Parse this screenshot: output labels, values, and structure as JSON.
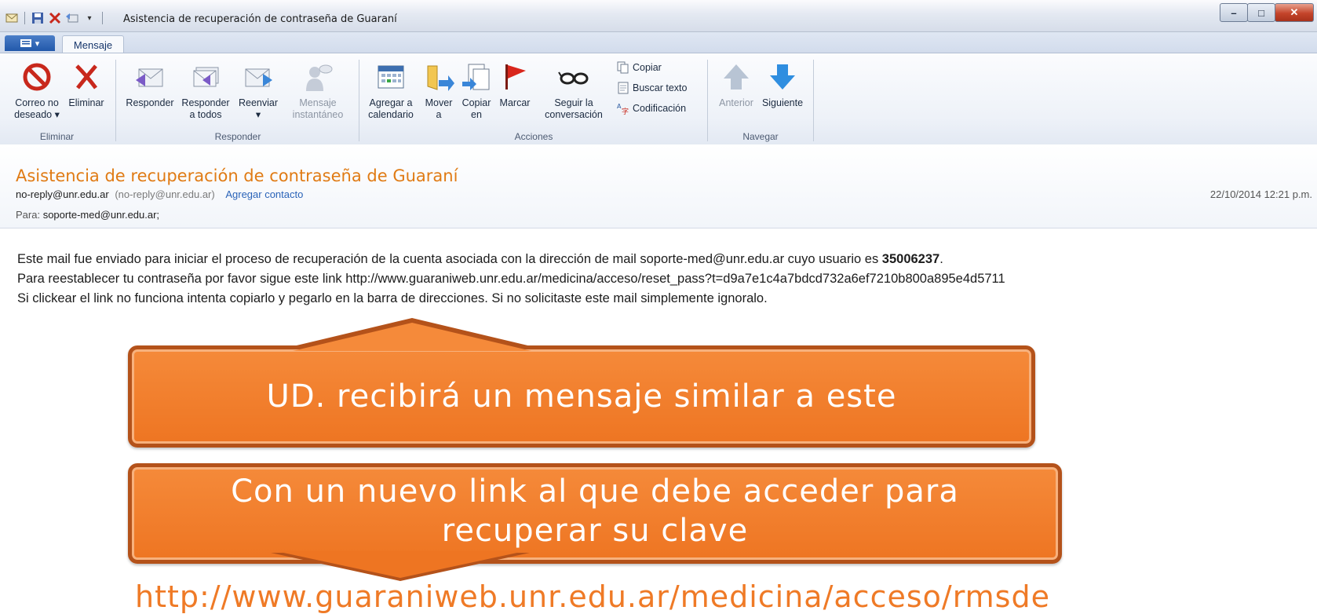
{
  "window": {
    "title": "Asistencia de recuperación de contraseña de Guaraní",
    "controls": [
      "minimize",
      "maximize",
      "close"
    ]
  },
  "ribbon": {
    "tab_active": "Mensaje",
    "groups": {
      "eliminar": {
        "label": "Eliminar",
        "correo_no_deseado": [
          "Correo no",
          "deseado ▾"
        ],
        "eliminar": "Eliminar"
      },
      "responder": {
        "label": "Responder",
        "responder": "Responder",
        "responder_todos": [
          "Responder",
          "a todos"
        ],
        "reenviar": [
          "Reenviar",
          "▾"
        ],
        "mensaje_instantaneo": [
          "Mensaje",
          "instantáneo"
        ]
      },
      "acciones": {
        "label": "Acciones",
        "agregar_calendario": [
          "Agregar a",
          "calendario"
        ],
        "mover": [
          "Mover",
          "a"
        ],
        "copiar_en": [
          "Copiar",
          "en"
        ],
        "marcar": "Marcar",
        "seguir": [
          "Seguir la",
          "conversación"
        ],
        "copiar": "Copiar",
        "buscar_texto": "Buscar texto",
        "codificacion": "Codificación"
      },
      "navegar": {
        "label": "Navegar",
        "anterior": "Anterior",
        "siguiente": "Siguiente"
      }
    }
  },
  "message": {
    "subject": "Asistencia de recuperación de contraseña de Guaraní",
    "from_address": "no-reply@unr.edu.ar",
    "from_display": "(no-reply@unr.edu.ar)",
    "add_contact": "Agregar contacto",
    "date": "22/10/2014 12:21 p.m.",
    "to_label": "Para:",
    "to_value": "soporte-med@unr.edu.ar;",
    "body": {
      "line1_prefix": "Este mail fue enviado para iniciar el proceso de recuperación de la cuenta asociada con la dirección de mail soporte-med@unr.edu.ar cuyo usuario es ",
      "line1_user": "35006237",
      "line1_suffix": ".",
      "line2": "Para reestablecer tu contraseña por favor sigue este link http://www.guaraniweb.unr.edu.ar/medicina/acceso/reset_pass?t=d9a7e1c4a7bdcd732a6ef7210b800a895e4d5711",
      "line3": "Si clickear el link no funciona intenta copiarlo y pegarlo en la barra de direcciones. Si no solicitaste este mail simplemente ignoralo."
    }
  },
  "annotations": {
    "callout1": "UD. recibirá un mensaje similar a este",
    "callout2_line1": "Con un nuevo link al que debe acceder para",
    "callout2_line2": "recuperar su clave",
    "bottom_link": "http://www.guaraniweb.unr.edu.ar/medicina/acceso/rmsde"
  },
  "colors": {
    "accent_orange": "#ee7522",
    "subject_orange": "#e07b14",
    "link_blue": "#2a63b8"
  }
}
